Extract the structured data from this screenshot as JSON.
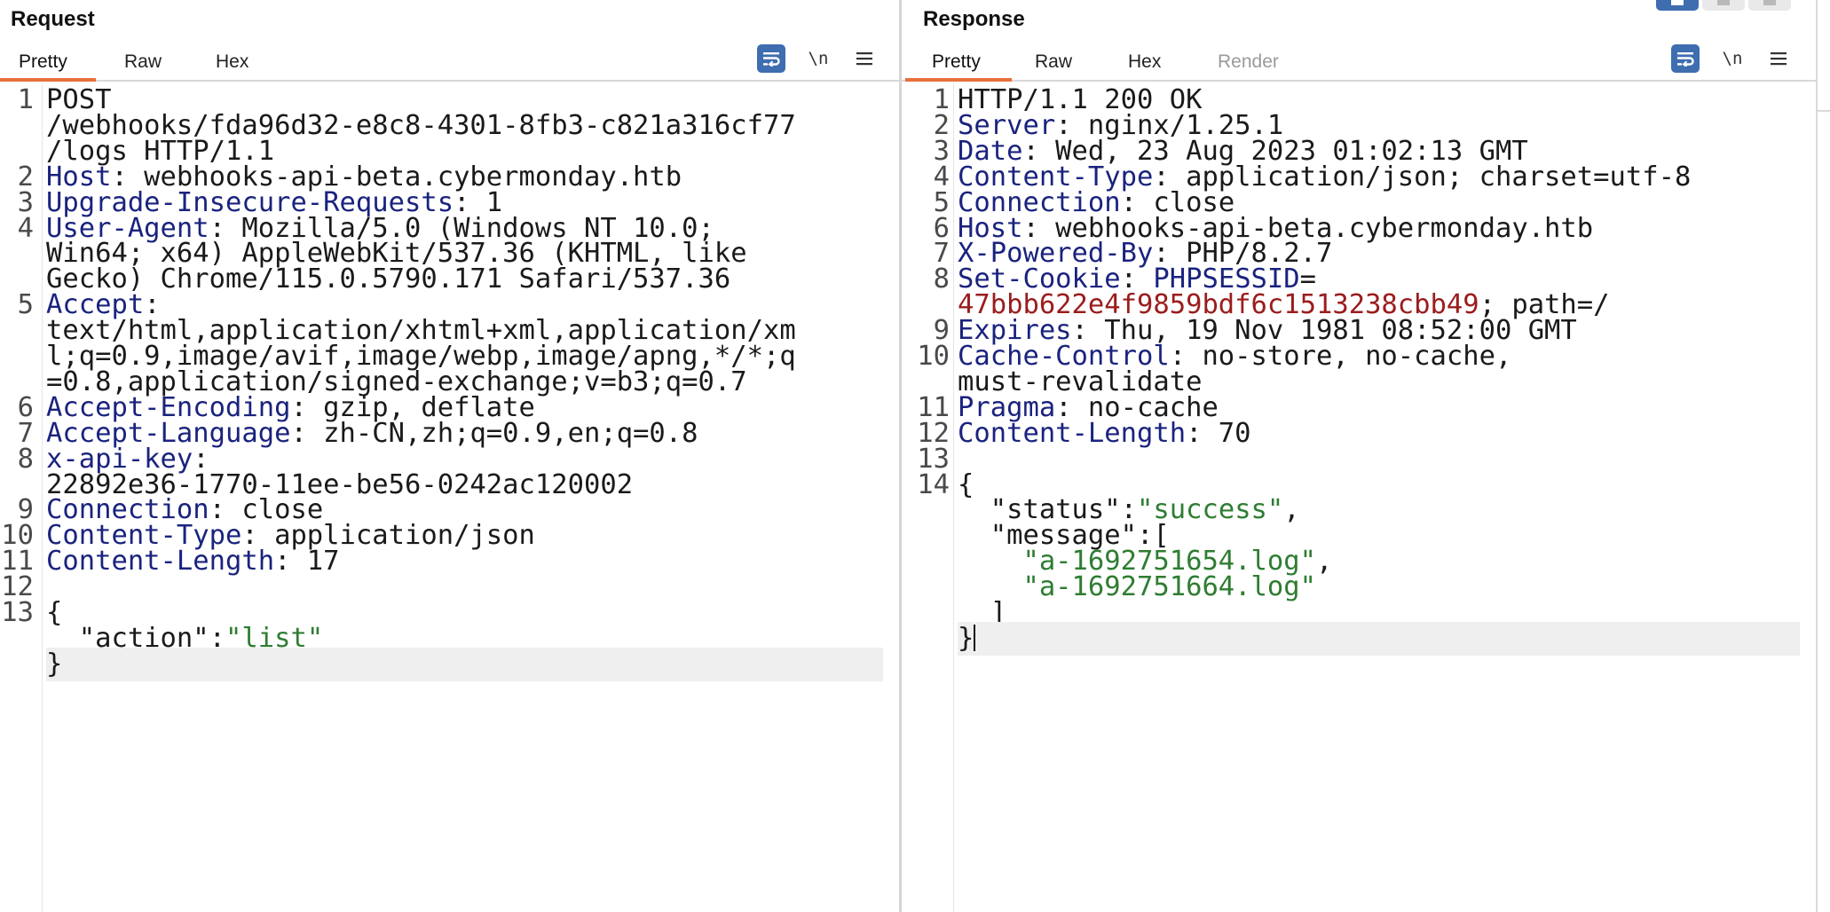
{
  "request": {
    "title": "Request",
    "tabs": [
      {
        "label": "Pretty",
        "active": true
      },
      {
        "label": "Raw"
      },
      {
        "label": "Hex"
      }
    ],
    "newline_label": "\\n",
    "lines": [
      {
        "n": "1",
        "parts": [
          {
            "t": "POST"
          }
        ]
      },
      {
        "n": "",
        "parts": [
          {
            "t": "/webhooks/fda96d32-e8c8-4301-8fb3-c821a316cf77"
          }
        ]
      },
      {
        "n": "",
        "parts": [
          {
            "t": "/logs HTTP/1.1"
          }
        ]
      },
      {
        "n": "2",
        "parts": [
          {
            "t": "Host",
            "c": "k"
          },
          {
            "t": ": webhooks-api-beta.cybermonday.htb"
          }
        ]
      },
      {
        "n": "3",
        "parts": [
          {
            "t": "Upgrade-Insecure-Requests",
            "c": "k"
          },
          {
            "t": ": 1"
          }
        ]
      },
      {
        "n": "4",
        "parts": [
          {
            "t": "User-Agent",
            "c": "k"
          },
          {
            "t": ": Mozilla/5.0 (Windows NT 10.0;"
          }
        ]
      },
      {
        "n": "",
        "parts": [
          {
            "t": "Win64; x64) AppleWebKit/537.36 (KHTML, like"
          }
        ]
      },
      {
        "n": "",
        "parts": [
          {
            "t": "Gecko) Chrome/115.0.5790.171 Safari/537.36"
          }
        ]
      },
      {
        "n": "5",
        "parts": [
          {
            "t": "Accept",
            "c": "k"
          },
          {
            "t": ":"
          }
        ]
      },
      {
        "n": "",
        "parts": [
          {
            "t": "text/html,application/xhtml+xml,application/xm"
          }
        ]
      },
      {
        "n": "",
        "parts": [
          {
            "t": "l;q=0.9,image/avif,image/webp,image/apng,*/*;q"
          }
        ]
      },
      {
        "n": "",
        "parts": [
          {
            "t": "=0.8,application/signed-exchange;v=b3;q=0.7"
          }
        ]
      },
      {
        "n": "6",
        "parts": [
          {
            "t": "Accept-Encoding",
            "c": "k"
          },
          {
            "t": ": gzip, deflate"
          }
        ]
      },
      {
        "n": "7",
        "parts": [
          {
            "t": "Accept-Language",
            "c": "k"
          },
          {
            "t": ": zh-CN,zh;q=0.9,en;q=0.8"
          }
        ]
      },
      {
        "n": "8",
        "parts": [
          {
            "t": "x-api-key",
            "c": "k"
          },
          {
            "t": ":"
          }
        ]
      },
      {
        "n": "",
        "parts": [
          {
            "t": "22892e36-1770-11ee-be56-0242ac120002"
          }
        ]
      },
      {
        "n": "9",
        "parts": [
          {
            "t": "Connection",
            "c": "k"
          },
          {
            "t": ": close"
          }
        ]
      },
      {
        "n": "10",
        "parts": [
          {
            "t": "Content-Type",
            "c": "k"
          },
          {
            "t": ": application/json"
          }
        ]
      },
      {
        "n": "11",
        "parts": [
          {
            "t": "Content-Length",
            "c": "k"
          },
          {
            "t": ": 17"
          }
        ]
      },
      {
        "n": "12",
        "parts": []
      },
      {
        "n": "13",
        "parts": [
          {
            "t": "{"
          }
        ]
      },
      {
        "n": "",
        "parts": [
          {
            "t": "  "
          },
          {
            "t": "\"action\""
          },
          {
            "t": ":"
          },
          {
            "t": "\"list\"",
            "c": "s"
          }
        ]
      },
      {
        "n": "",
        "parts": [
          {
            "t": "}"
          }
        ],
        "highlight": true
      }
    ]
  },
  "response": {
    "title": "Response",
    "tabs": [
      {
        "label": "Pretty",
        "active": true
      },
      {
        "label": "Raw"
      },
      {
        "label": "Hex"
      },
      {
        "label": "Render",
        "disabled": true
      }
    ],
    "newline_label": "\\n",
    "lines": [
      {
        "n": "1",
        "parts": [
          {
            "t": "HTTP/1.1 200 OK"
          }
        ]
      },
      {
        "n": "2",
        "parts": [
          {
            "t": "Server",
            "c": "k"
          },
          {
            "t": ": nginx/1.25.1"
          }
        ]
      },
      {
        "n": "3",
        "parts": [
          {
            "t": "Date",
            "c": "k"
          },
          {
            "t": ": Wed, 23 Aug 2023 01:02:13 GMT"
          }
        ]
      },
      {
        "n": "4",
        "parts": [
          {
            "t": "Content-Type",
            "c": "k"
          },
          {
            "t": ": application/json; charset=utf-8"
          }
        ]
      },
      {
        "n": "5",
        "parts": [
          {
            "t": "Connection",
            "c": "k"
          },
          {
            "t": ": close"
          }
        ]
      },
      {
        "n": "6",
        "parts": [
          {
            "t": "Host",
            "c": "k"
          },
          {
            "t": ": webhooks-api-beta.cybermonday.htb"
          }
        ]
      },
      {
        "n": "7",
        "parts": [
          {
            "t": "X-Powered-By",
            "c": "k"
          },
          {
            "t": ": PHP/8.2.7"
          }
        ]
      },
      {
        "n": "8",
        "parts": [
          {
            "t": "Set-Cookie",
            "c": "k"
          },
          {
            "t": ": "
          },
          {
            "t": "PHPSESSID",
            "c": "ck"
          },
          {
            "t": "="
          }
        ]
      },
      {
        "n": "",
        "parts": [
          {
            "t": "47bbb622e4f9859bdf6c1513238cbb49",
            "c": "cv"
          },
          {
            "t": "; path=/"
          }
        ]
      },
      {
        "n": "9",
        "parts": [
          {
            "t": "Expires",
            "c": "k"
          },
          {
            "t": ": Thu, 19 Nov 1981 08:52:00 GMT"
          }
        ]
      },
      {
        "n": "10",
        "parts": [
          {
            "t": "Cache-Control",
            "c": "k"
          },
          {
            "t": ": no-store, no-cache,"
          }
        ]
      },
      {
        "n": "",
        "parts": [
          {
            "t": "must-revalidate"
          }
        ]
      },
      {
        "n": "11",
        "parts": [
          {
            "t": "Pragma",
            "c": "k"
          },
          {
            "t": ": no-cache"
          }
        ]
      },
      {
        "n": "12",
        "parts": [
          {
            "t": "Content-Length",
            "c": "k"
          },
          {
            "t": ": 70"
          }
        ]
      },
      {
        "n": "13",
        "parts": []
      },
      {
        "n": "14",
        "parts": [
          {
            "t": "{"
          }
        ]
      },
      {
        "n": "",
        "parts": [
          {
            "t": "  "
          },
          {
            "t": "\"status\""
          },
          {
            "t": ":"
          },
          {
            "t": "\"success\"",
            "c": "s"
          },
          {
            "t": ","
          }
        ]
      },
      {
        "n": "",
        "parts": [
          {
            "t": "  "
          },
          {
            "t": "\"message\""
          },
          {
            "t": ":["
          }
        ]
      },
      {
        "n": "",
        "parts": [
          {
            "t": "    "
          },
          {
            "t": "\"a-1692751654.log\"",
            "c": "s"
          },
          {
            "t": ","
          }
        ]
      },
      {
        "n": "",
        "parts": [
          {
            "t": "    "
          },
          {
            "t": "\"a-1692751664.log\"",
            "c": "s"
          }
        ]
      },
      {
        "n": "",
        "parts": [
          {
            "t": "  ]"
          }
        ]
      },
      {
        "n": "",
        "parts": [
          {
            "t": "}"
          }
        ],
        "highlight": true,
        "cursor": true
      }
    ]
  },
  "colors": {
    "accent_underline": "#e8703a",
    "wrap_button": "#3e6db0",
    "header_key": "#1a237e",
    "json_string": "#2e7d32",
    "cookie_value": "#9b1c1c"
  },
  "icons": {
    "wrap": "wrap-lines-icon",
    "menu": "hamburger-menu-icon"
  }
}
